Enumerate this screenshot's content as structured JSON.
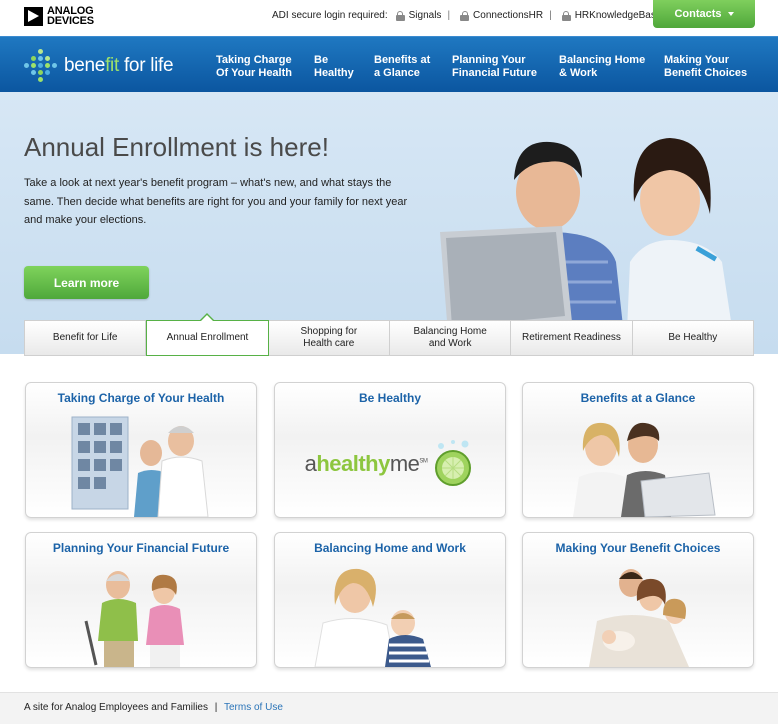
{
  "header": {
    "logo_line1": "ANALOG",
    "logo_line2": "DEVICES",
    "secure_label": "ADI secure login required:",
    "secure_links": [
      "Signals",
      "ConnectionsHR",
      "HRKnowledgeBase"
    ],
    "separator": "|",
    "contacts_label": "Contacts"
  },
  "nav": {
    "brand_part1": "bene",
    "brand_part2": "fit",
    "brand_part3": " for life",
    "items": [
      {
        "line1": "Taking Charge",
        "line2": "Of Your Health"
      },
      {
        "line1": "Be",
        "line2": "Healthy"
      },
      {
        "line1": "Benefits at",
        "line2": "a Glance"
      },
      {
        "line1": "Planning Your",
        "line2": "Financial Future"
      },
      {
        "line1": "Balancing Home",
        "line2": "& Work"
      },
      {
        "line1": "Making Your",
        "line2": "Benefit Choices"
      }
    ]
  },
  "hero": {
    "title": "Annual Enrollment is here!",
    "text": "Take a look at next year's benefit program – what's new, and what stays the same. Then decide what benefits are right for you and your family for next year and make your elections.",
    "button_label": "Learn more"
  },
  "tabs": [
    {
      "line1": "Benefit for Life",
      "line2": "",
      "active": false
    },
    {
      "line1": "Annual Enrollment",
      "line2": "",
      "active": true
    },
    {
      "line1": "Shopping for",
      "line2": "Health care",
      "active": false
    },
    {
      "line1": "Balancing Home",
      "line2": "and Work",
      "active": false
    },
    {
      "line1": "Retirement Readiness",
      "line2": "",
      "active": false
    },
    {
      "line1": "Be Healthy",
      "line2": "",
      "active": false
    }
  ],
  "cards": [
    {
      "title": "Taking Charge of Your Health"
    },
    {
      "title": "Be Healthy",
      "logo_a": "a",
      "logo_healthy": "healthy",
      "logo_me": "me",
      "logo_sm": "SM"
    },
    {
      "title": "Benefits at a Glance"
    },
    {
      "title": "Planning Your Financial Future"
    },
    {
      "title": "Balancing Home and Work"
    },
    {
      "title": "Making Your Benefit Choices"
    }
  ],
  "footer": {
    "text": "A site for Analog Employees and Families",
    "separator": "|",
    "link": "Terms of Use"
  },
  "colors": {
    "nav_blue": "#1565b0",
    "accent_green": "#57b146",
    "card_title_blue": "#1c63a8",
    "hero_bg": "#d0e2f2"
  }
}
